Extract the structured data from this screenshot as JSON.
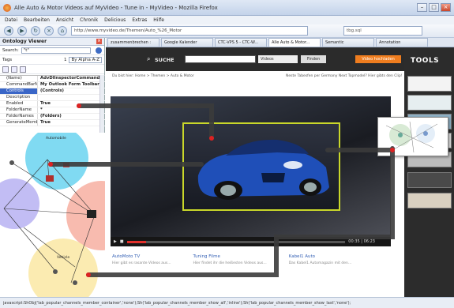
{
  "window": {
    "title": "Alle Auto & Motor Videos auf MyVideo - Tune in - MyVideo - Mozilla Firefox"
  },
  "menu": [
    "Datei",
    "Bearbeiten",
    "Ansicht",
    "Chronik",
    "Delicious",
    "Extras",
    "Hilfe"
  ],
  "nav": {
    "url": "http://www.myvideo.de/Themen/Auto_%26_Motor",
    "search_value": "tbg.sql"
  },
  "sidebar": {
    "title": "Ontology Viewer",
    "search_label": "Search:",
    "search_value": "\"t\"",
    "tags_label": "Tags",
    "sort_number": "1",
    "sort_value": "By Alpha A-Z",
    "properties": [
      {
        "key": "(Name)",
        "value": "AdvDllnspectorCommand"
      },
      {
        "key": "CommandBarName",
        "value": "My Outlook Form Toolbar"
      },
      {
        "key": "Controls",
        "value": "(Controls)",
        "selected": true
      },
      {
        "key": "Description",
        "value": ""
      },
      {
        "key": "Enabled",
        "value": "True"
      },
      {
        "key": "FolderName",
        "value": "*"
      },
      {
        "key": "FolderNames",
        "value": "(Folders)"
      },
      {
        "key": "GenerateMember",
        "value": "True"
      }
    ],
    "diagram_label_top": "Automobile",
    "diagram_label_bottom": "Vehicle"
  },
  "tabs": [
    {
      "label": "zusammenbrechen :",
      "active": false
    },
    {
      "label": "Google Kalender",
      "active": false
    },
    {
      "label": "CTC-VPS 5 - CTC-W...",
      "active": false
    },
    {
      "label": "Alle Auto & Motor...",
      "active": true
    },
    {
      "label": "Semantic",
      "active": false
    },
    {
      "label": "Annotation",
      "active": false
    }
  ],
  "page": {
    "search_label": "SUCHE",
    "select_value": "Videos",
    "find_button": "Finden",
    "upload_button": "Video hochladen",
    "tools_title": "TOOLS",
    "breadcrumb": "Du bist hier: Home > Themen > Auto & Motor",
    "breadcrumb_right": "Neste Tabesfen per Germany Next Topmodel? Hier gibts den Clip!",
    "player": {
      "time_current": "00:35",
      "time_total": "06:23",
      "progress": 0.09
    },
    "below_columns": [
      {
        "title": "AutoMoto TV",
        "sub": "Hier gibt es rasante Videos aus..."
      },
      {
        "title": "Tuning Filme",
        "sub": "Hier findet ihr die heißesten Videos aus..."
      },
      {
        "title": "Kabel1 Auto",
        "sub": "Das Kabel1 Automagazin mit den..."
      }
    ]
  },
  "status_bar": "javascript:ShObj('lab_popular_channels_member_container','none');Sh('lab_popular_channels_member_show_all','inline');Sh('lab_popular_channels_member_show_last','none');",
  "colors": {
    "accent_orange": "#ef7d1f",
    "highlight_yellow": "#c9d72a",
    "selection_blue": "#3a66c7",
    "car_blue": "#1f4fb8"
  }
}
